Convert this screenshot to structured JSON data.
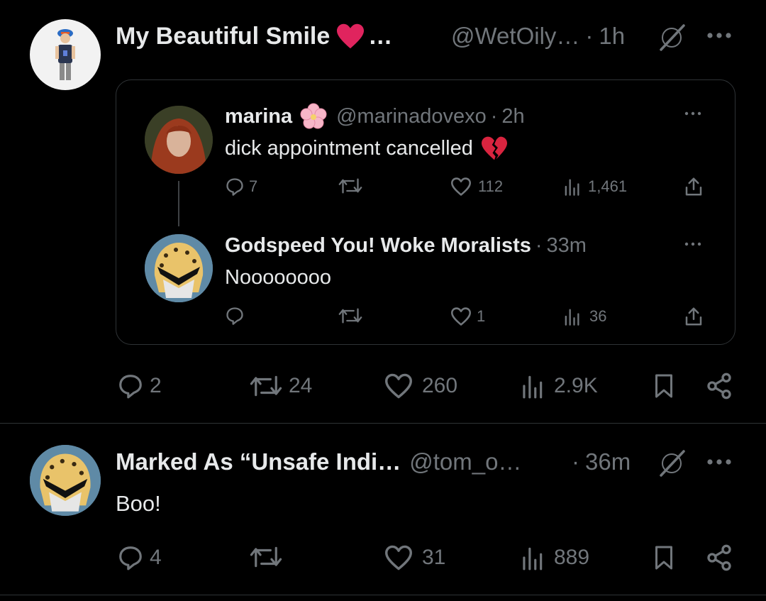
{
  "post1": {
    "display_name": "My Beautiful Smile",
    "name_suffix": "…",
    "handle": "@WetOily…",
    "dot": "·",
    "time": "1h",
    "quote": {
      "tweet1": {
        "name": "marina",
        "handle": "@marinadovexo",
        "dot": "·",
        "time": "2h",
        "text": "dick appointment cancelled",
        "replies": "7",
        "likes": "112",
        "views": "1,461"
      },
      "tweet2": {
        "name": "Godspeed You! Woke Moralists",
        "dot": "·",
        "time": "33m",
        "text": "Noooooooo",
        "likes": "1",
        "views": "36"
      }
    },
    "stats": {
      "replies": "2",
      "reposts": "24",
      "likes": "260",
      "views": "2.9K"
    }
  },
  "post2": {
    "display_name": "Marked As “Unsafe Indi…",
    "handle": "@tom_o…",
    "dot": "·",
    "time": "36m",
    "text": "Boo!",
    "stats": {
      "replies": "4",
      "likes": "31",
      "views": "889"
    }
  },
  "colors": {
    "background": "#000000",
    "text": "#e7e9ea",
    "muted": "#71767b",
    "border": "#2f3336",
    "heart_red": "#e0245e"
  }
}
